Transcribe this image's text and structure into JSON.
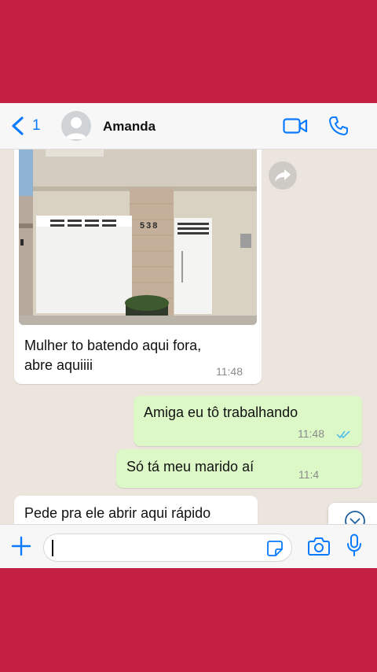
{
  "header": {
    "back_count": "1",
    "contact_name": "Amanda"
  },
  "photo": {
    "house_number": "538"
  },
  "messages": [
    {
      "direction": "in",
      "line1": "Mulher to batendo aqui fora,",
      "line2": "abre aquiiii",
      "time": "11:48"
    },
    {
      "direction": "out",
      "text": "Amiga eu tô trabalhando",
      "time": "11:48"
    },
    {
      "direction": "out",
      "text": "Só tá meu marido aí",
      "time": "11:4"
    },
    {
      "direction": "in",
      "text": "Pede pra ele abrir aqui rápido"
    }
  ],
  "icons": {
    "back": "chevron-left-icon",
    "avatar": "user-avatar-icon",
    "video": "video-camera-icon",
    "call": "phone-icon",
    "forward": "forward-arrow-icon",
    "scroll": "chevron-down-circle-icon",
    "plus": "plus-icon",
    "sticker": "sticker-icon",
    "camera": "camera-icon",
    "mic": "microphone-icon"
  },
  "colors": {
    "background": "#c32044",
    "accent": "#0a7aff",
    "outgoing_bubble": "#dcf8c6",
    "incoming_bubble": "#ffffff",
    "chat_background": "#ece5dd",
    "read_ticks": "#53bdeb"
  }
}
